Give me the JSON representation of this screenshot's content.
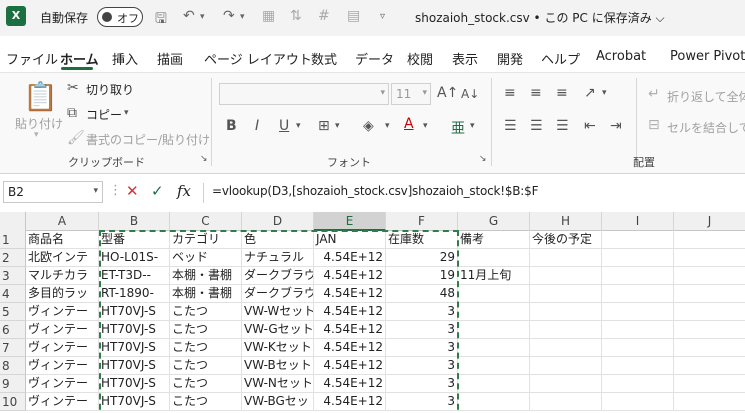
{
  "titlebar": {
    "logo": "X",
    "autosave_label": "自動保存",
    "autosave_state": "オフ",
    "filename": "shozaioh_stock.csv • この PC に保存済み ⌵"
  },
  "tabs": [
    "ファイル",
    "ホーム",
    "挿入",
    "描画",
    "ページ レイアウト",
    "数式",
    "データ",
    "校閲",
    "表示",
    "開発",
    "ヘルプ",
    "Acrobat",
    "Power Pivot"
  ],
  "ribbon": {
    "paste": "貼り付け",
    "cut": "切り取り",
    "copy": "コピー",
    "format_painter": "書式のコピー/貼り付け",
    "clipboard_group": "クリップボード",
    "font_size": "11",
    "font_group": "フォント",
    "wrap_text": "折り返して全体を",
    "merge": "セルを結合して中",
    "align_group": "配置"
  },
  "formula_bar": {
    "name_box": "B2",
    "cancel": "✕",
    "enter": "✓",
    "fx": "fx",
    "formula": "=vlookup(D3,[shozaioh_stock.csv]shozaioh_stock!$B:$F"
  },
  "columns": [
    "A",
    "B",
    "C",
    "D",
    "E",
    "F",
    "G",
    "H",
    "I",
    "J"
  ],
  "rows": [
    {
      "n": "1",
      "cells": [
        "商品名",
        "型番",
        "カテゴリ",
        "色",
        "JAN",
        "在庫数",
        "備考",
        "今後の予定",
        "",
        ""
      ]
    },
    {
      "n": "2",
      "cells": [
        "北欧インテ",
        "HO-L01S-",
        "ベッド",
        "ナチュラル",
        "4.54E+12",
        "29",
        "",
        "",
        "",
        ""
      ]
    },
    {
      "n": "3",
      "cells": [
        "マルチカラ",
        "ET-T3D--",
        "本棚・書棚",
        "ダークブラウ",
        "4.54E+12",
        "19",
        "11月上旬",
        "",
        "",
        ""
      ]
    },
    {
      "n": "4",
      "cells": [
        "多目的ラッ",
        "RT-1890-",
        "本棚・書棚",
        "ダークブラウ",
        "4.54E+12",
        "48",
        "",
        "",
        "",
        ""
      ]
    },
    {
      "n": "5",
      "cells": [
        "ヴィンテー",
        "HT70VJ-S",
        "こたつ",
        "VW-Wセット",
        "4.54E+12",
        "3",
        "",
        "",
        "",
        ""
      ]
    },
    {
      "n": "6",
      "cells": [
        "ヴィンテー",
        "HT70VJ-S",
        "こたつ",
        "VW-Gセット",
        "4.54E+12",
        "3",
        "",
        "",
        "",
        ""
      ]
    },
    {
      "n": "7",
      "cells": [
        "ヴィンテー",
        "HT70VJ-S",
        "こたつ",
        "VW-Kセット",
        "4.54E+12",
        "3",
        "",
        "",
        "",
        ""
      ]
    },
    {
      "n": "8",
      "cells": [
        "ヴィンテー",
        "HT70VJ-S",
        "こたつ",
        "VW-Bセット",
        "4.54E+12",
        "3",
        "",
        "",
        "",
        ""
      ]
    },
    {
      "n": "9",
      "cells": [
        "ヴィンテー",
        "HT70VJ-S",
        "こたつ",
        "VW-Nセット",
        "4.54E+12",
        "3",
        "",
        "",
        "",
        ""
      ]
    },
    {
      "n": "10",
      "cells": [
        "ヴィンテー",
        "HT70VJ-S",
        "こたつ",
        "VW-BGセッ",
        "4.54E+12",
        "3",
        "",
        "",
        "",
        ""
      ]
    }
  ],
  "colors": {
    "accent": "#1d6f42",
    "cancel": "#d13438",
    "enter": "#1d6f42"
  }
}
